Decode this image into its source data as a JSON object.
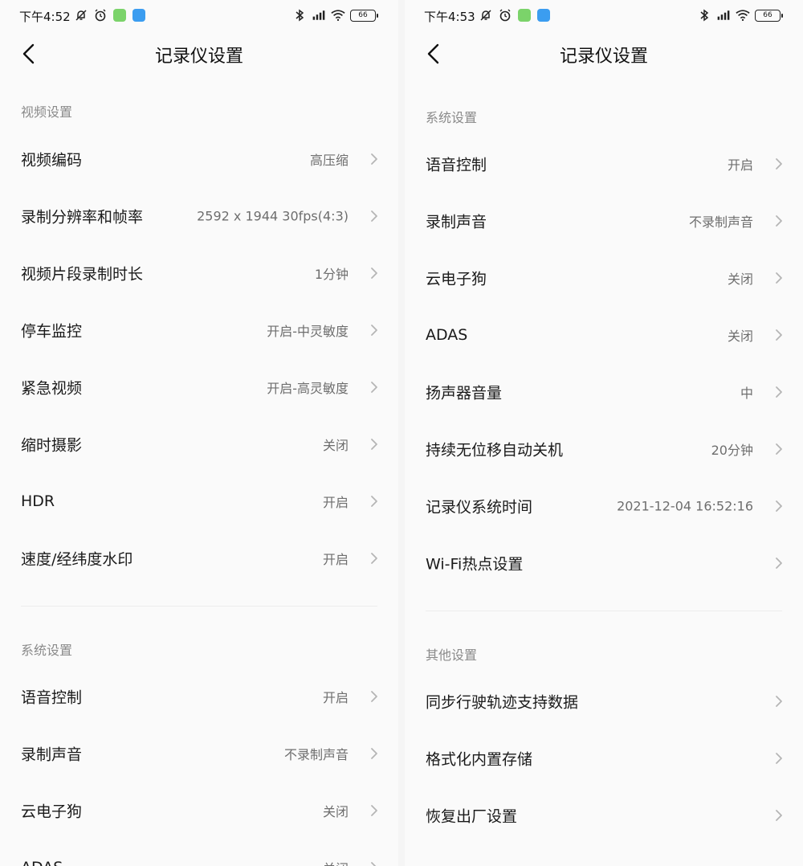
{
  "left": {
    "status": {
      "time": "下午4:52",
      "battery": "66"
    },
    "title": "记录仪设置",
    "video_section": {
      "title": "视频设置",
      "items": [
        {
          "label": "视频编码",
          "value": "高压缩"
        },
        {
          "label": "录制分辨率和帧率",
          "value": "2592 x 1944 30fps(4:3)"
        },
        {
          "label": "视频片段录制时长",
          "value": "1分钟"
        },
        {
          "label": "停车监控",
          "value": "开启-中灵敏度"
        },
        {
          "label": "紧急视频",
          "value": "开启-高灵敏度"
        },
        {
          "label": "缩时摄影",
          "value": "关闭"
        },
        {
          "label": "HDR",
          "value": "开启"
        },
        {
          "label": "速度/经纬度水印",
          "value": "开启"
        }
      ]
    },
    "system_section": {
      "title": "系统设置",
      "items": [
        {
          "label": "语音控制",
          "value": "开启"
        },
        {
          "label": "录制声音",
          "value": "不录制声音"
        },
        {
          "label": "云电子狗",
          "value": "关闭"
        },
        {
          "label": "ADAS",
          "value": "关闭"
        }
      ]
    }
  },
  "right": {
    "status": {
      "time": "下午4:53",
      "battery": "66"
    },
    "title": "记录仪设置",
    "system_section": {
      "title": "系统设置",
      "items": [
        {
          "label": "语音控制",
          "value": "开启"
        },
        {
          "label": "录制声音",
          "value": "不录制声音"
        },
        {
          "label": "云电子狗",
          "value": "关闭"
        },
        {
          "label": "ADAS",
          "value": "关闭"
        },
        {
          "label": "扬声器音量",
          "value": "中"
        },
        {
          "label": "持续无位移自动关机",
          "value": "20分钟"
        },
        {
          "label": "记录仪系统时间",
          "value": "2021-12-04 16:52:16"
        },
        {
          "label": "Wi-Fi热点设置",
          "value": ""
        }
      ]
    },
    "other_section": {
      "title": "其他设置",
      "items": [
        {
          "label": "同步行驶轨迹支持数据",
          "value": ""
        },
        {
          "label": "格式化内置存储",
          "value": ""
        },
        {
          "label": "恢复出厂设置",
          "value": ""
        }
      ]
    }
  },
  "icons": [
    "mute-bell-icon",
    "alarm-icon",
    "app-green-icon",
    "app-blue-icon",
    "bluetooth-icon",
    "signal-icon",
    "wifi-icon",
    "battery-icon",
    "back-arrow-icon",
    "chevron-right-icon"
  ]
}
